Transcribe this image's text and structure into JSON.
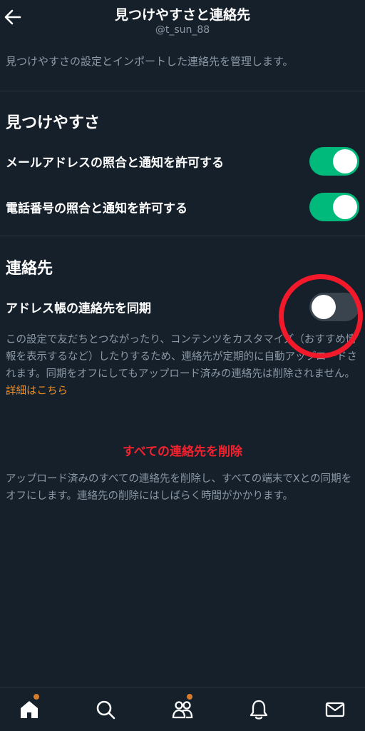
{
  "header": {
    "title": "見つけやすさと連絡先",
    "username": "@t_sun_88",
    "back_icon": "arrow-left-icon"
  },
  "description": "見つけやすさの設定とインポートした連絡先を管理します。",
  "discoverability": {
    "title": "見つけやすさ",
    "email_toggle": {
      "label": "メールアドレスの照合と通知を許可する",
      "on": true
    },
    "phone_toggle": {
      "label": "電話番号の照合と通知を許可する",
      "on": true
    }
  },
  "contacts": {
    "title": "連絡先",
    "sync_toggle": {
      "label": "アドレス帳の連絡先を同期",
      "on": false
    },
    "help": "この設定で友だちとつながったり、コンテンツをカスタマイズ（おすすめ情報を表示するなど）したりするため、連絡先が定期的に自動アップロードされます。同期をオフにしてもアップロード済みの連絡先は削除されません。",
    "help_link": "詳細はこちら",
    "delete_label": "すべての連絡先を削除",
    "delete_help": "アップロード済みのすべての連絡先を削除し、すべての端末でXとの同期をオフにします。連絡先の削除にはしばらく時間がかかります。"
  },
  "tabbar": {
    "items": [
      "home-icon",
      "search-icon",
      "communities-icon",
      "notifications-icon",
      "messages-icon"
    ]
  },
  "colors": {
    "background": "#15202b",
    "toggle_on": "#00ba7c",
    "link": "#f28f1e",
    "danger": "#f4212e",
    "annotation": "#f2192a"
  }
}
